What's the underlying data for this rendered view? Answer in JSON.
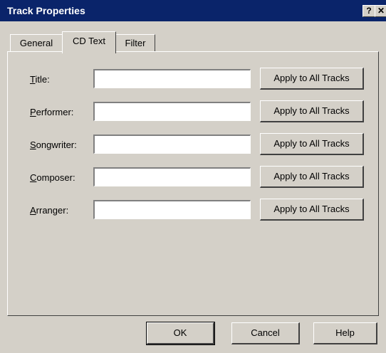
{
  "window": {
    "title": "Track Properties",
    "help_glyph": "?",
    "close_glyph": "✕"
  },
  "tabs": [
    {
      "label": "General",
      "active": false
    },
    {
      "label": "CD Text",
      "active": true
    },
    {
      "label": "Filter",
      "active": false
    }
  ],
  "fields": [
    {
      "label": "Title:",
      "mnemonic": "T",
      "rest": "itle:",
      "value": "",
      "apply_label": "Apply to All Tracks"
    },
    {
      "label": "Performer:",
      "mnemonic": "P",
      "rest": "erformer:",
      "value": "",
      "apply_label": "Apply to All Tracks"
    },
    {
      "label": "Songwriter:",
      "mnemonic": "S",
      "rest": "ongwriter:",
      "value": "",
      "apply_label": "Apply to All Tracks"
    },
    {
      "label": "Composer:",
      "mnemonic": "C",
      "rest": "omposer:",
      "value": "",
      "apply_label": "Apply to All Tracks"
    },
    {
      "label": "Arranger:",
      "mnemonic": "A",
      "rest": "rranger:",
      "value": "",
      "apply_label": "Apply to All Tracks"
    }
  ],
  "buttons": {
    "ok": "OK",
    "cancel": "Cancel",
    "help": "Help"
  },
  "colors": {
    "titlebar": "#0a246a",
    "face": "#d4d0c8"
  }
}
